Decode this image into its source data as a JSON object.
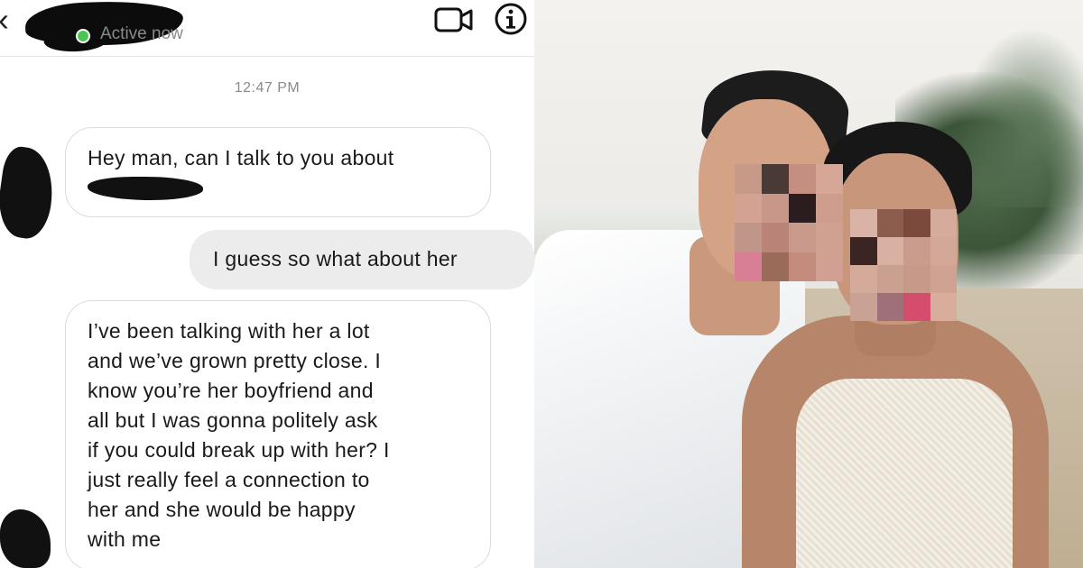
{
  "chat": {
    "header": {
      "back_icon": "chevron-left-icon",
      "status": "Active now",
      "status_color": "#4cc553",
      "icons": [
        "video-call-icon",
        "info-icon"
      ]
    },
    "timestamp": "12:47 PM",
    "messages": [
      {
        "direction": "incoming",
        "text": "Hey man, can I talk to you about"
      },
      {
        "direction": "outgoing",
        "text": "I guess so what about her"
      },
      {
        "direction": "incoming",
        "lines": [
          "I’ve been talking with her a lot",
          "and we’ve grown pretty close. I",
          "know you’re her boyfriend and",
          "all but I was gonna politely ask",
          "if you could break up with her? I",
          "just really feel a connection to",
          "her and she would be happy",
          "with me"
        ]
      }
    ]
  },
  "photo": {
    "subject": "couple-selfie-beach",
    "faces": "pixelated"
  },
  "colors": {
    "incoming_bubble_border": "#dcdcdc",
    "outgoing_bubble_bg": "#ececec",
    "timestamp_text": "#8a8a8a"
  }
}
